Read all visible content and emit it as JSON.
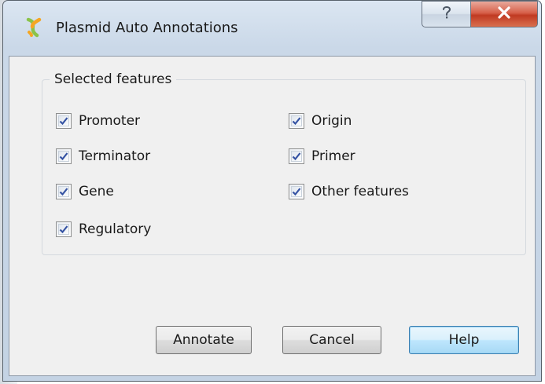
{
  "window": {
    "title": "Plasmid Auto Annotations",
    "help_icon": "question-mark-icon",
    "close_icon": "close-x-icon"
  },
  "group": {
    "legend": "Selected features"
  },
  "features": [
    {
      "label": "Promoter",
      "checked": true
    },
    {
      "label": "Terminator",
      "checked": true
    },
    {
      "label": "Gene",
      "checked": true
    },
    {
      "label": "Regulatory",
      "checked": true
    },
    {
      "label": "Origin",
      "checked": true
    },
    {
      "label": "Primer",
      "checked": true
    },
    {
      "label": "Other features",
      "checked": true
    }
  ],
  "buttons": {
    "annotate": "Annotate",
    "cancel": "Cancel",
    "help": "Help"
  },
  "colors": {
    "check_mark": "#3553a3",
    "close_button": "#c8462c",
    "default_button_border": "#3c7fb1",
    "app_icon_green": "#8bc34a",
    "app_icon_orange": "#f5a623"
  }
}
